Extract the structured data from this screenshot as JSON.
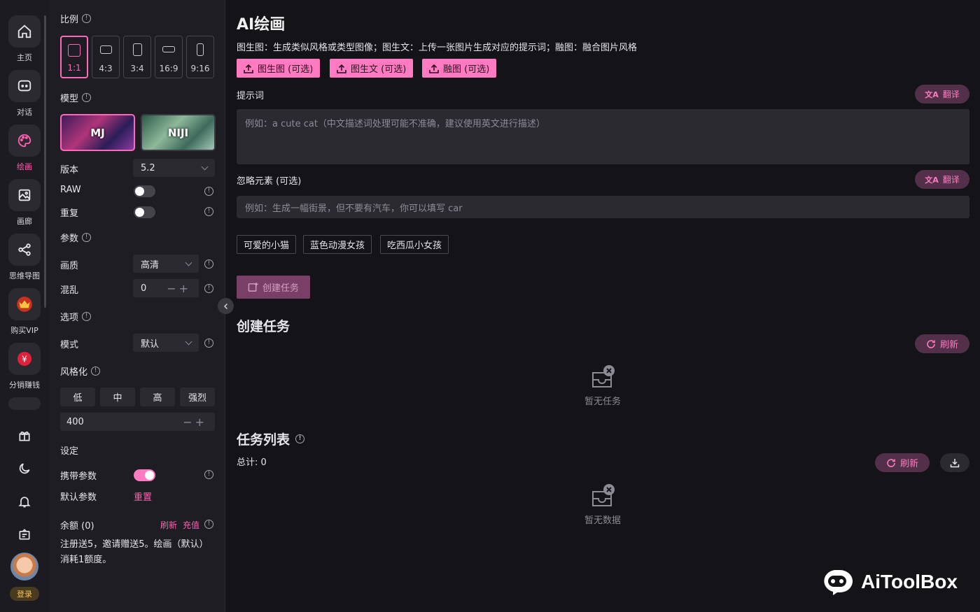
{
  "nav": {
    "items": [
      {
        "label": "主页",
        "icon": "home-icon"
      },
      {
        "label": "对话",
        "icon": "chat-icon"
      },
      {
        "label": "绘画",
        "icon": "palette-icon"
      },
      {
        "label": "画廊",
        "icon": "gallery-icon"
      },
      {
        "label": "思维导图",
        "icon": "mindmap-icon"
      },
      {
        "label": "购买VIP",
        "icon": "vip-icon"
      },
      {
        "label": "分销赚钱",
        "icon": "money-icon"
      }
    ],
    "active": "绘画",
    "login_label": "登录"
  },
  "settings": {
    "ratio_title": "比例",
    "ratios": [
      "1:1",
      "4:3",
      "3:4",
      "16:9",
      "9:16"
    ],
    "ratio_selected": "1:1",
    "model_title": "模型",
    "models": [
      "MJ",
      "NIJI"
    ],
    "model_selected": "MJ",
    "version_label": "版本",
    "version_value": "5.2",
    "raw_label": "RAW",
    "raw_on": false,
    "repeat_label": "重复",
    "repeat_on": false,
    "params_title": "参数",
    "quality_label": "画质",
    "quality_value": "高清",
    "chaos_label": "混乱",
    "chaos_value": "0",
    "options_title": "选项",
    "mode_label": "模式",
    "mode_value": "默认",
    "stylize_title": "风格化",
    "stylize_options": [
      "低",
      "中",
      "高",
      "强烈"
    ],
    "stylize_value": "400",
    "setting_title": "设定",
    "carry_params_label": "携带参数",
    "carry_params_on": true,
    "default_params_label": "默认参数",
    "default_params_reset": "重置",
    "balance_label": "余额 (0)",
    "balance_refresh": "刷新",
    "balance_recharge": "充值",
    "note_line1": "注册送5，邀请赠送5。绘画（默认）",
    "note_line2": "消耗1额度。"
  },
  "main": {
    "title": "AI绘画",
    "description": "图生图：生成类似风格或类型图像；图生文：上传一张图片生成对应的提示词；融图：融合图片风格",
    "upload_buttons": [
      "图生图 (可选)",
      "图生文 (可选)",
      "融图 (可选)"
    ],
    "prompt_label": "提示词",
    "translate_label": "翻译",
    "prompt_placeholder": "例如：a cute cat（中文描述词处理可能不准确，建议使用英文进行描述）",
    "negative_label": "忽略元素 (可选)",
    "negative_placeholder": "例如：生成一幅街景，但不要有汽车，你可以填写 car",
    "examples": [
      "可爱的小猫",
      "蓝色动漫女孩",
      "吃西瓜小女孩"
    ],
    "create_button": "创建任务",
    "create_section_title": "创建任务",
    "refresh_label": "刷新",
    "no_tasks": "暂无任务",
    "task_list_title": "任务列表",
    "total_label": "总计: 0",
    "no_data": "暂无数据"
  },
  "watermark": "AiToolBox",
  "colors": {
    "accent": "#ff7ac0",
    "background": "#141318",
    "panel": "#1e1d24"
  }
}
